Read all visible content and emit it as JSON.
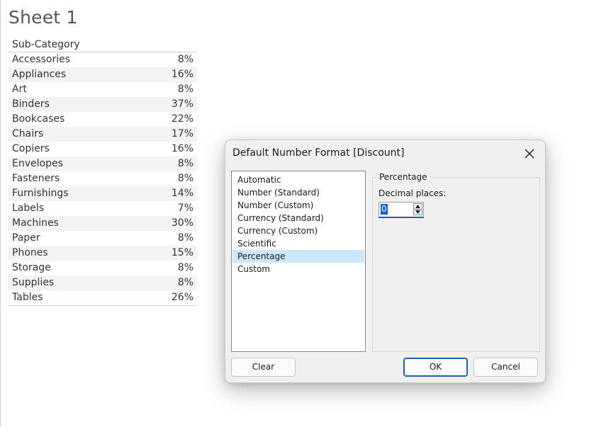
{
  "sheet": {
    "title": "Sheet 1",
    "column_header": "Sub-Category",
    "rows": [
      {
        "name": "Accessories",
        "value": "8%"
      },
      {
        "name": "Appliances",
        "value": "16%"
      },
      {
        "name": "Art",
        "value": "8%"
      },
      {
        "name": "Binders",
        "value": "37%"
      },
      {
        "name": "Bookcases",
        "value": "22%"
      },
      {
        "name": "Chairs",
        "value": "17%"
      },
      {
        "name": "Copiers",
        "value": "16%"
      },
      {
        "name": "Envelopes",
        "value": "8%"
      },
      {
        "name": "Fasteners",
        "value": "8%"
      },
      {
        "name": "Furnishings",
        "value": "14%"
      },
      {
        "name": "Labels",
        "value": "7%"
      },
      {
        "name": "Machines",
        "value": "30%"
      },
      {
        "name": "Paper",
        "value": "8%"
      },
      {
        "name": "Phones",
        "value": "15%"
      },
      {
        "name": "Storage",
        "value": "8%"
      },
      {
        "name": "Supplies",
        "value": "8%"
      },
      {
        "name": "Tables",
        "value": "26%"
      }
    ]
  },
  "dialog": {
    "title": "Default Number Format [Discount]",
    "close_icon": "close-icon",
    "format_list": [
      "Automatic",
      "Number (Standard)",
      "Number (Custom)",
      "Currency (Standard)",
      "Currency (Custom)",
      "Scientific",
      "Percentage",
      "Custom"
    ],
    "selected_format": "Percentage",
    "group_label": "Percentage",
    "decimal_places_label": "Decimal places:",
    "decimal_places_value": "0",
    "buttons": {
      "clear": "Clear",
      "ok": "OK",
      "cancel": "Cancel"
    }
  },
  "colors": {
    "selection_highlight": "#cce8ff",
    "accent": "#1e5fb0"
  }
}
